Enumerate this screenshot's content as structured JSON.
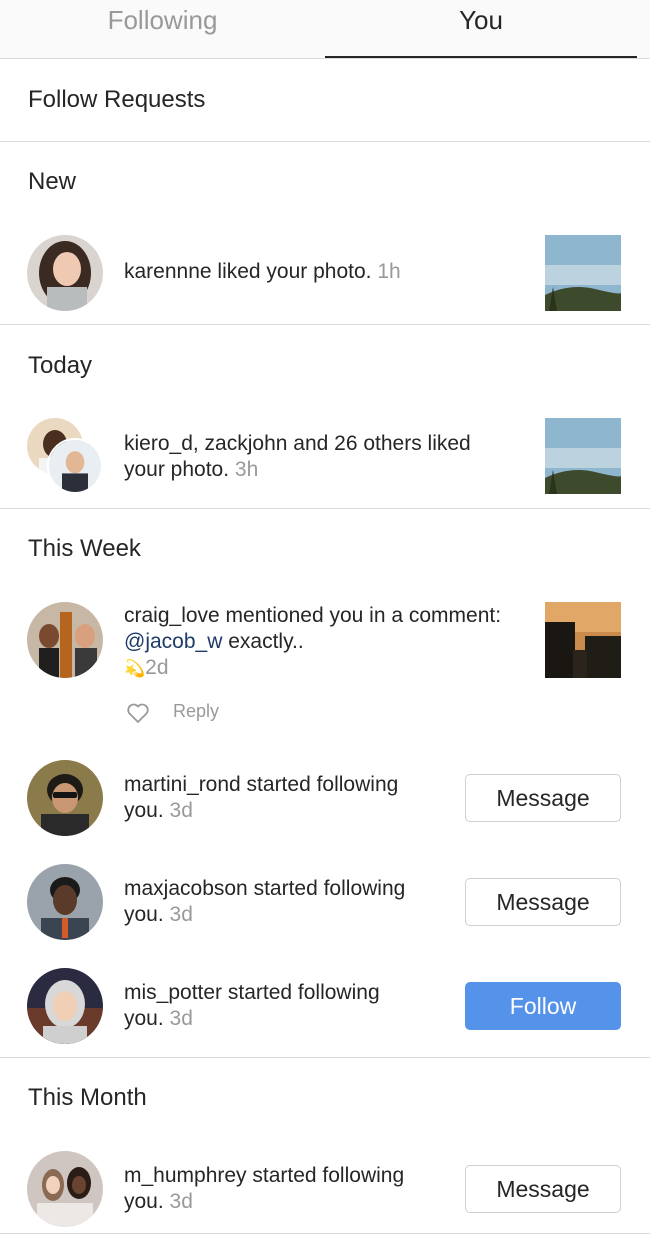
{
  "tabs": {
    "following": "Following",
    "you": "You"
  },
  "sections": {
    "follow_requests": "Follow Requests",
    "new": "New",
    "today": "Today",
    "this_week": "This Week",
    "this_month": "This Month"
  },
  "notifications": [
    {
      "text": "karennne liked your photo.",
      "time": "1h"
    },
    {
      "line1": "kiero_d, zackjohn and 26 others liked",
      "line2": "your photo.",
      "time": "3h"
    },
    {
      "line1": "craig_love mentioned you in a comment:",
      "mention": "@jacob_w",
      "line2_rest": " exactly..",
      "emoji": "💫",
      "time": "2d",
      "reply": "Reply"
    },
    {
      "line1": "martini_rond started following",
      "line2": "you.",
      "time": "3d",
      "button": "Message"
    },
    {
      "line1": "maxjacobson started following",
      "line2": "you.",
      "time": "3d",
      "button": "Message"
    },
    {
      "line1": "mis_potter started following",
      "line2": "you.",
      "time": "3d",
      "button": "Follow"
    },
    {
      "line1": "m_humphrey started following",
      "line2": "you.",
      "time": "3d",
      "button": "Message"
    }
  ],
  "colors": {
    "follow_button": "#5592ea",
    "mention": "#1e3a68",
    "muted": "#999999"
  }
}
